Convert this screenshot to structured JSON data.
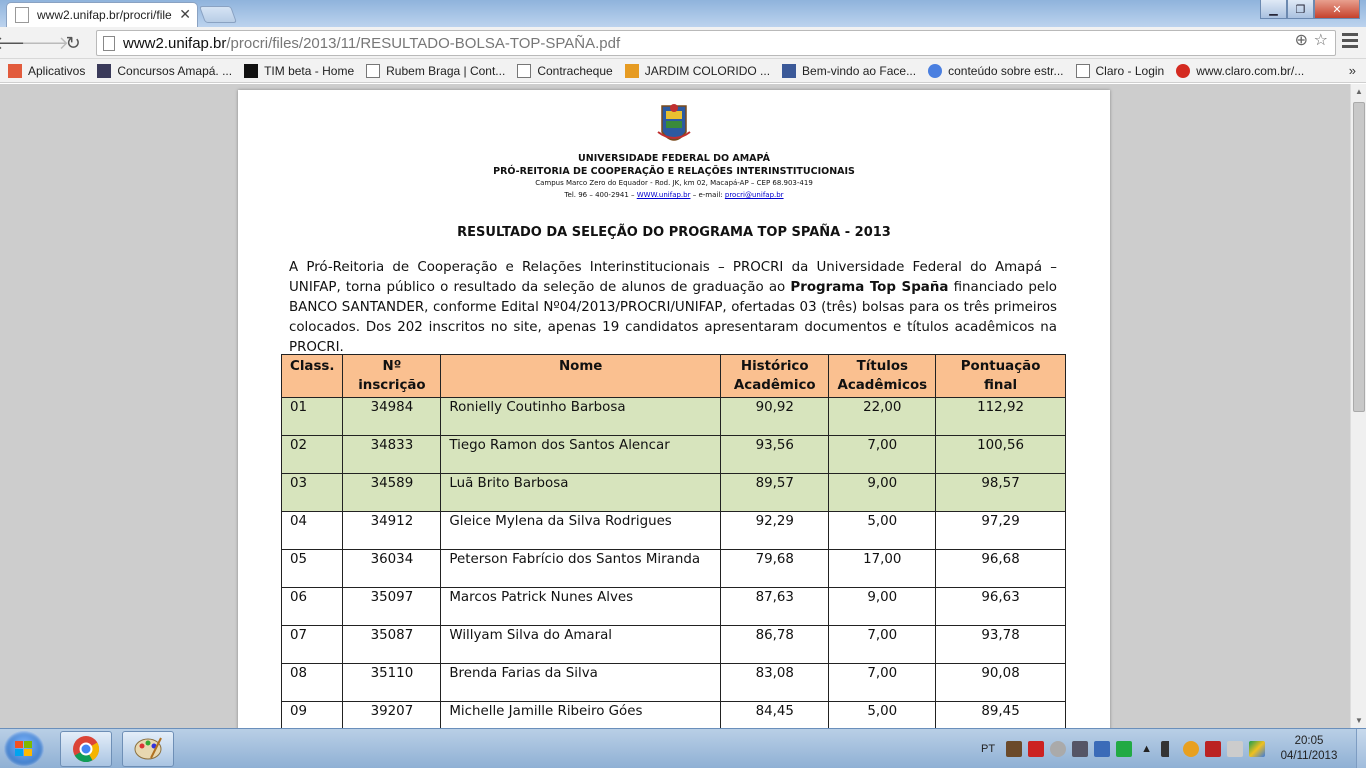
{
  "browser": {
    "tab_title": "www2.unifap.br/procri/file",
    "url_host": "www2.unifap.br",
    "url_path": "/procri/files/2013/11/RESULTADO-BOLSA-TOP-SPAÑA.pdf",
    "bookmarks": [
      {
        "label": "Aplicativos",
        "icon": "apps-grid-icon",
        "color": "#e25b3c"
      },
      {
        "label": "Concursos Amapá. ...",
        "icon": "site-favicon",
        "color": "#3a3a5a"
      },
      {
        "label": "TIM beta - Home",
        "icon": "tim-icon",
        "color": "#111111"
      },
      {
        "label": "Rubem Braga | Cont...",
        "icon": "page-icon",
        "color": "#ffffff"
      },
      {
        "label": "Contracheque",
        "icon": "page-icon",
        "color": "#ffffff"
      },
      {
        "label": "JARDIM COLORIDO ...",
        "icon": "pencil-icon",
        "color": "#e69b22"
      },
      {
        "label": "Bem-vindo ao Face...",
        "icon": "facebook-icon",
        "color": "#3b5998"
      },
      {
        "label": "conteúdo sobre estr...",
        "icon": "google-icon",
        "color": "#4a7fe0"
      },
      {
        "label": "Claro - Login",
        "icon": "page-icon",
        "color": "#ffffff"
      },
      {
        "label": "www.claro.com.br/...",
        "icon": "claro-icon",
        "color": "#d42a20"
      }
    ]
  },
  "pdf": {
    "header": {
      "line1": "UNIVERSIDADE FEDERAL DO AMAPÁ",
      "line2": "PRÓ-REITORIA DE COOPERAÇÃO E RELAÇÕES INTERINSTITUCIONAIS",
      "line3": "Campus Marco Zero do Equador - Rod. JK, km 02, Macapá-AP – CEP 68.903-419",
      "phone": "Tel. 96 – 400-2941 –",
      "website": "WWW.unifap.br",
      "email_label": "– e-mail:",
      "email": "procri@unifap.br"
    },
    "title": "RESULTADO DA SELEÇÃO DO PROGRAMA TOP SPAÑA - 2013",
    "intro_before": "A Pró-Reitoria de Cooperação e Relações Interinstitucionais – PROCRI da Universidade Federal do Amapá – UNIFAP, torna público o resultado da seleção de alunos de graduação ao ",
    "intro_bold": "Programa Top Spaña",
    "intro_after": " financiado pelo BANCO SANTANDER, conforme Edital Nº04/2013/PROCRI/UNIFAP, ofertadas 03 (três) bolsas para os três primeiros colocados. Dos 202 inscritos no site, apenas 19 candidatos apresentaram documentos e títulos acadêmicos na PROCRI.",
    "columns": [
      "Class.",
      "Nº inscrição",
      "Nome",
      "Histórico Acadêmico",
      "Títulos Acadêmicos",
      "Pontuação final"
    ],
    "rows": [
      [
        "01",
        "34984",
        "Ronielly Coutinho Barbosa",
        "90,92",
        "22,00",
        "112,92"
      ],
      [
        "02",
        "34833",
        "Tiego Ramon dos Santos Alencar",
        "93,56",
        "7,00",
        "100,56"
      ],
      [
        "03",
        "34589",
        "Luã Brito Barbosa",
        "89,57",
        "9,00",
        "98,57"
      ],
      [
        "04",
        "34912",
        "Gleice Mylena da Silva Rodrigues",
        "92,29",
        "5,00",
        "97,29"
      ],
      [
        "05",
        "36034",
        "Peterson Fabrício dos Santos Miranda",
        "79,68",
        "17,00",
        "96,68"
      ],
      [
        "06",
        "35097",
        "Marcos Patrick Nunes Alves",
        "87,63",
        "9,00",
        "96,63"
      ],
      [
        "07",
        "35087",
        "Willyam Silva do Amaral",
        "86,78",
        "7,00",
        "93,78"
      ],
      [
        "08",
        "35110",
        "Brenda Farias da Silva",
        "83,08",
        "7,00",
        "90,08"
      ],
      [
        "09",
        "39207",
        "Michelle Jamille Ribeiro Góes",
        "84,45",
        "5,00",
        "89,45"
      ]
    ],
    "highlight_color": "#d7e4bd",
    "header_color": "#fac090"
  },
  "taskbar": {
    "language": "PT",
    "time": "20:05",
    "date": "04/11/2013"
  }
}
